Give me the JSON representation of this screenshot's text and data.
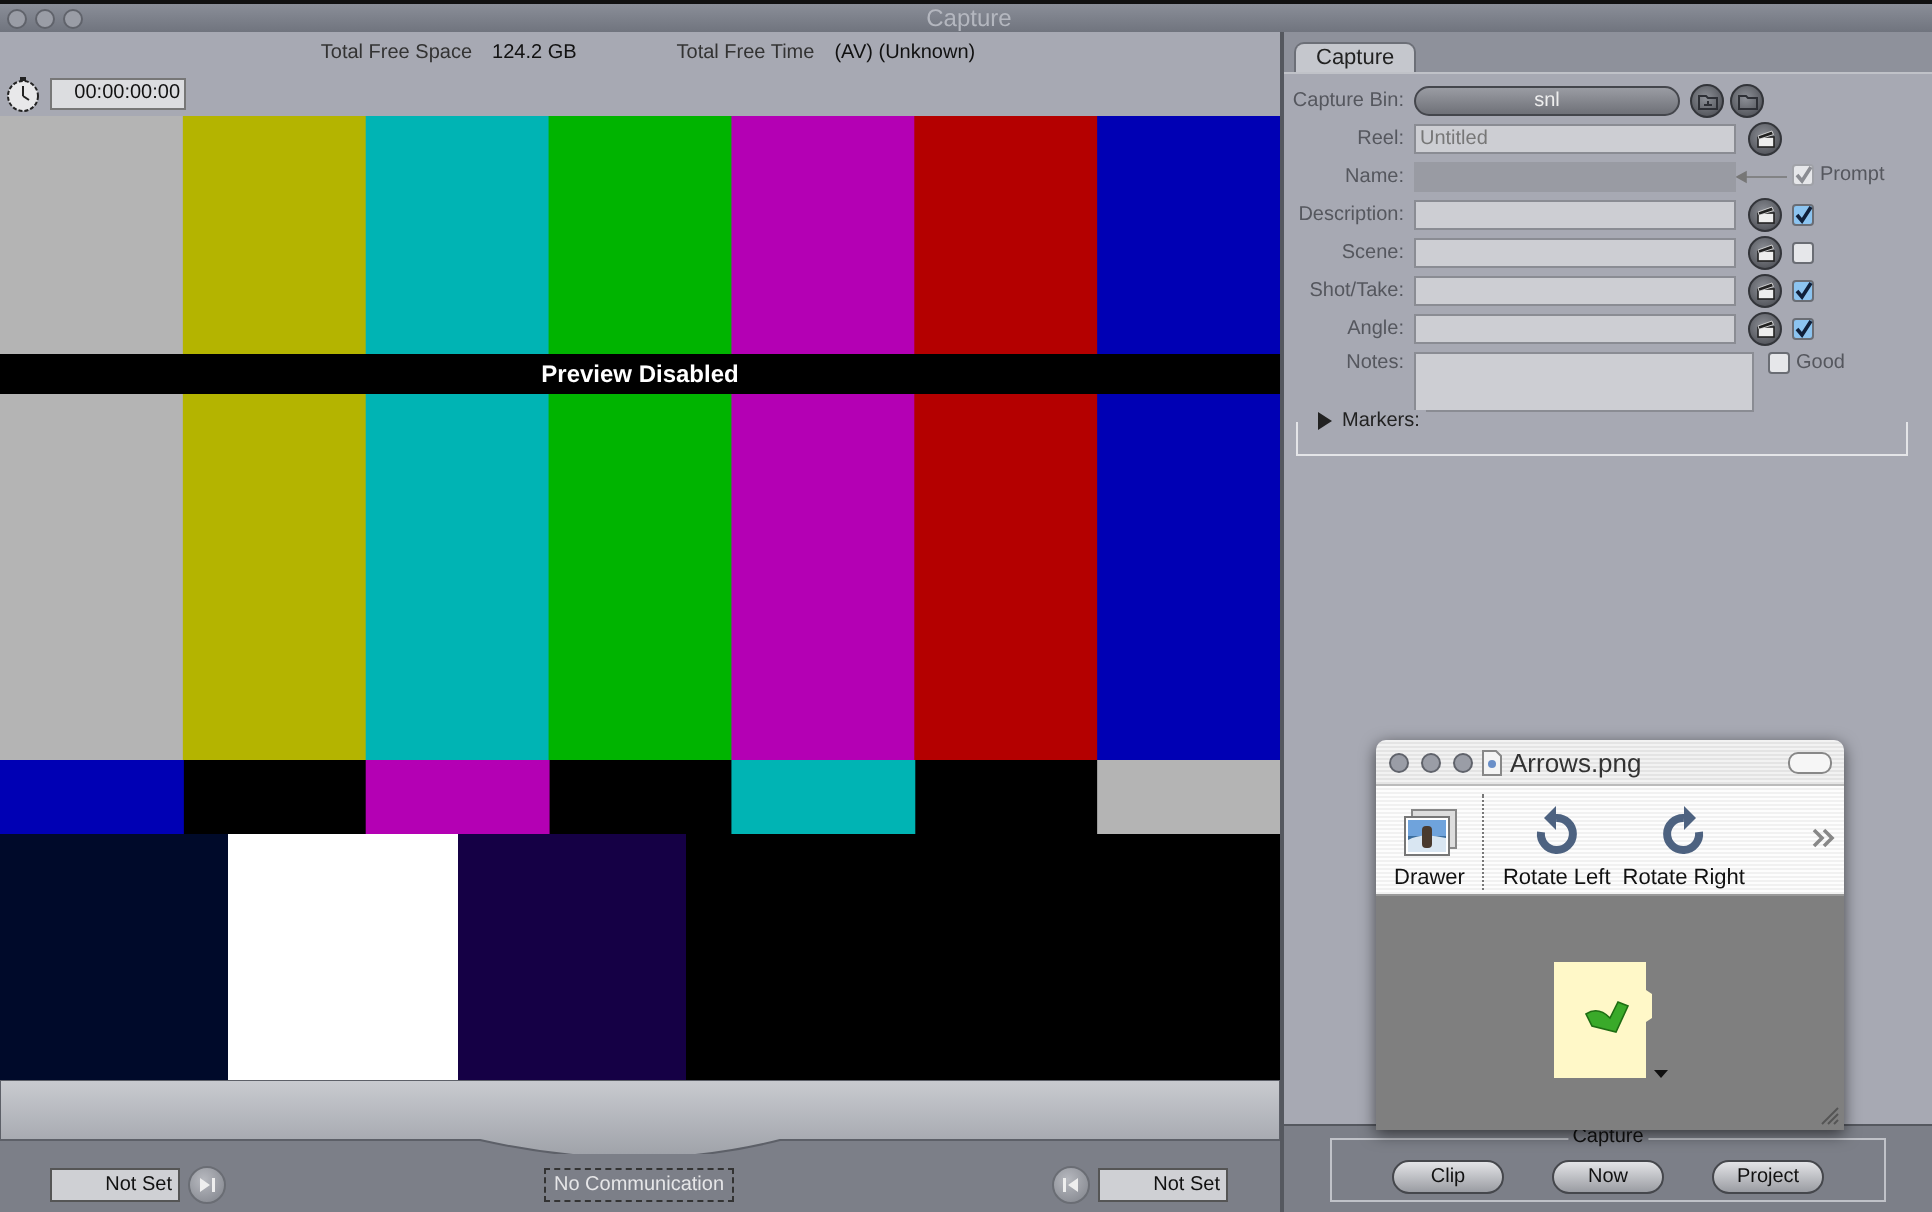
{
  "window": {
    "title": "Capture"
  },
  "viewer": {
    "free_space_label": "Total Free Space",
    "free_space": "124.2 GB",
    "free_time_label": "Total Free Time",
    "free_time": "(AV) (Unknown)",
    "timecode": "00:00:00:00",
    "overlay": "Preview Disabled",
    "in_point": "Not Set",
    "device_status": "No Communication",
    "out_point": "Not Set"
  },
  "log_panel": {
    "tabs": [
      {
        "label": "Capture",
        "selected": true
      }
    ],
    "capture_bin": {
      "label": "Capture Bin:",
      "value": "snl"
    },
    "fields": [
      {
        "label": "Reel:",
        "kind": "reel",
        "value": "Untitled"
      },
      {
        "label": "Name:",
        "kind": "name",
        "prompt": {
          "label": "Prompt",
          "checked": true
        }
      },
      {
        "label": "Description:",
        "kind": "logged",
        "checked": true
      },
      {
        "label": "Scene:",
        "kind": "logged",
        "checked": false
      },
      {
        "label": "Shot/Take:",
        "kind": "logged",
        "checked": true
      },
      {
        "label": "Angle:",
        "kind": "logged",
        "checked": true
      },
      {
        "label": "Notes:",
        "kind": "notes",
        "good": {
          "label": "Good",
          "checked": false
        }
      }
    ],
    "markers": {
      "label": "Markers:",
      "expanded": false
    }
  },
  "capture_group": {
    "label": "Capture",
    "buttons": [
      "Clip",
      "Now",
      "Project"
    ]
  },
  "image_window": {
    "title": "Arrows.png",
    "toolbar": [
      {
        "label": "Drawer",
        "kind": "drawer"
      },
      {
        "label": "Rotate Left",
        "kind": "rotate_left"
      },
      {
        "label": "Rotate Right",
        "kind": "rotate_right"
      }
    ]
  }
}
